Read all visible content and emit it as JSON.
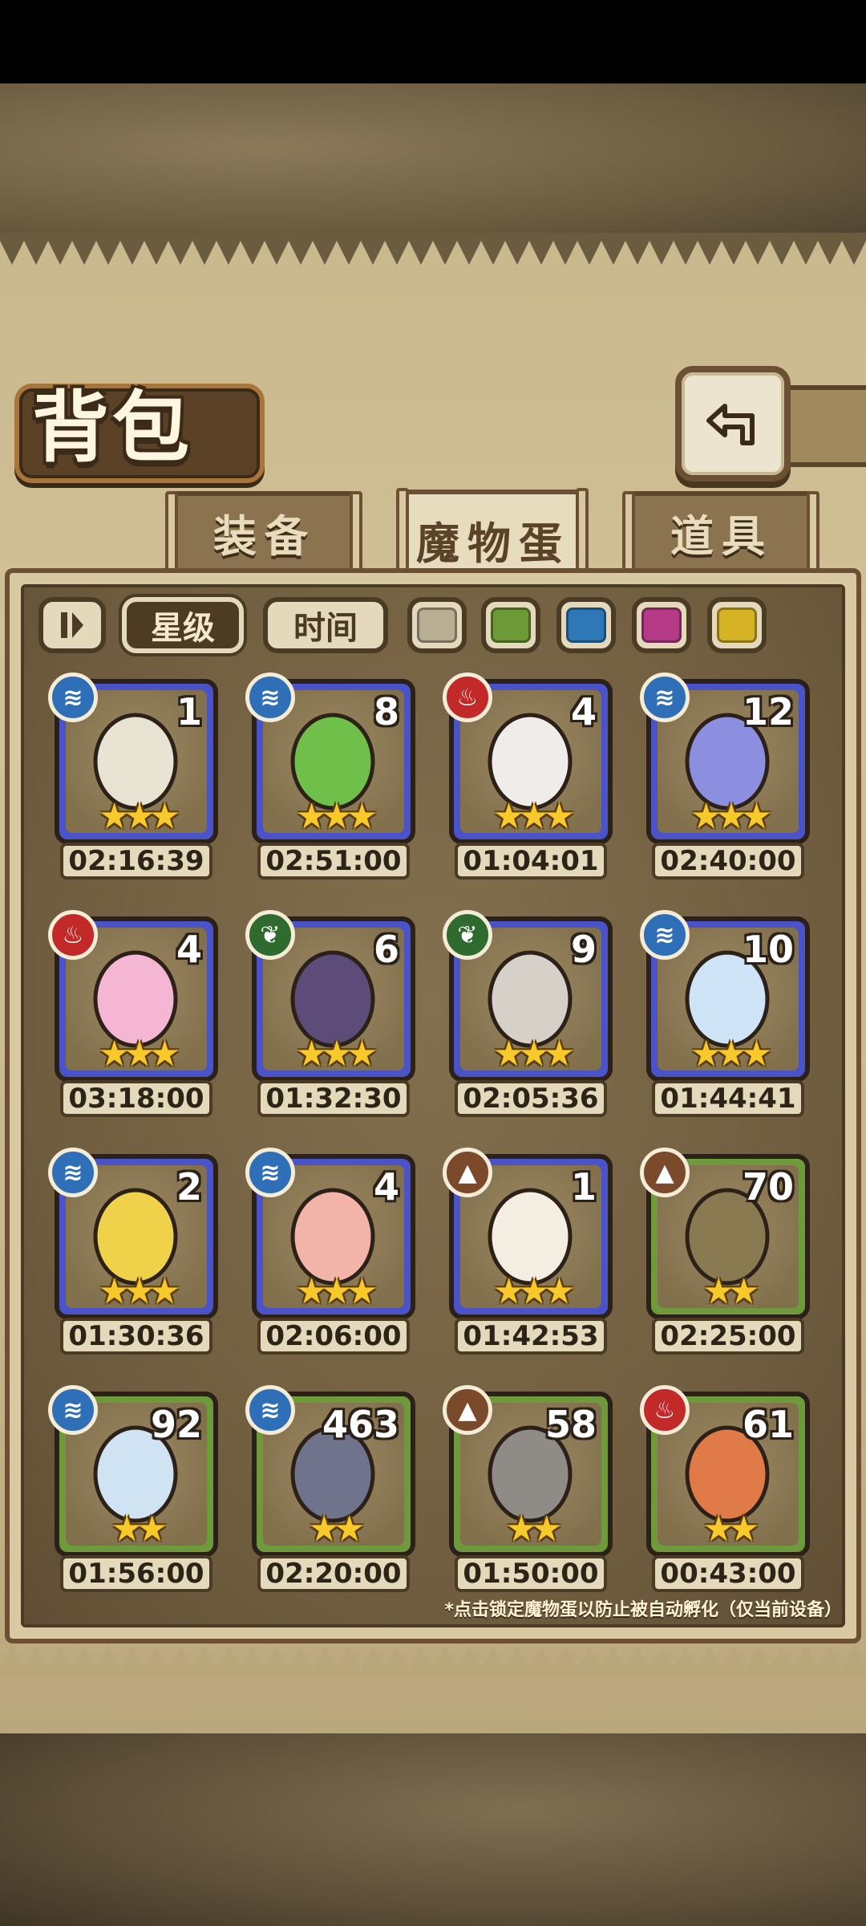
{
  "title": "背包",
  "tabs": [
    {
      "label": "装备",
      "active": false
    },
    {
      "label": "魔物蛋",
      "active": true
    },
    {
      "label": "道具",
      "active": false
    }
  ],
  "filters": {
    "sort_star_label": "星级",
    "sort_time_label": "时间",
    "color_swatches": [
      "#b9ad92",
      "#6d9a36",
      "#2f78b8",
      "#b43a87",
      "#d6b324"
    ]
  },
  "eggs": [
    {
      "count": "1",
      "timer": "02:16:39",
      "element": "water",
      "stars": 3,
      "frame": "blue"
    },
    {
      "count": "8",
      "timer": "02:51:00",
      "element": "water",
      "stars": 3,
      "frame": "blue"
    },
    {
      "count": "4",
      "timer": "01:04:01",
      "element": "fire",
      "stars": 3,
      "frame": "blue"
    },
    {
      "count": "12",
      "timer": "02:40:00",
      "element": "water",
      "stars": 3,
      "frame": "blue"
    },
    {
      "count": "4",
      "timer": "03:18:00",
      "element": "fire",
      "stars": 3,
      "frame": "blue"
    },
    {
      "count": "6",
      "timer": "01:32:30",
      "element": "grass",
      "stars": 3,
      "frame": "blue"
    },
    {
      "count": "9",
      "timer": "02:05:36",
      "element": "grass",
      "stars": 3,
      "frame": "blue"
    },
    {
      "count": "10",
      "timer": "01:44:41",
      "element": "water",
      "stars": 3,
      "frame": "blue"
    },
    {
      "count": "2",
      "timer": "01:30:36",
      "element": "water",
      "stars": 3,
      "frame": "blue"
    },
    {
      "count": "4",
      "timer": "02:06:00",
      "element": "water",
      "stars": 3,
      "frame": "blue"
    },
    {
      "count": "1",
      "timer": "01:42:53",
      "element": "earth",
      "stars": 3,
      "frame": "blue"
    },
    {
      "count": "70",
      "timer": "02:25:00",
      "element": "earth",
      "stars": 2,
      "frame": "green"
    },
    {
      "count": "92",
      "timer": "01:56:00",
      "element": "water",
      "stars": 2,
      "frame": "green"
    },
    {
      "count": "463",
      "timer": "02:20:00",
      "element": "water",
      "stars": 2,
      "frame": "green"
    },
    {
      "count": "58",
      "timer": "01:50:00",
      "element": "earth",
      "stars": 2,
      "frame": "green"
    },
    {
      "count": "61",
      "timer": "00:43:00",
      "element": "fire",
      "stars": 2,
      "frame": "green"
    }
  ],
  "footnote": "*点击锁定魔物蛋以防止被自动孵化（仅当前设备）",
  "colors": {
    "parchment": "#c9b88d",
    "panel": "#6f5c3e",
    "blue_frame": "#4a54c8",
    "green_frame": "#6f9a3c"
  }
}
